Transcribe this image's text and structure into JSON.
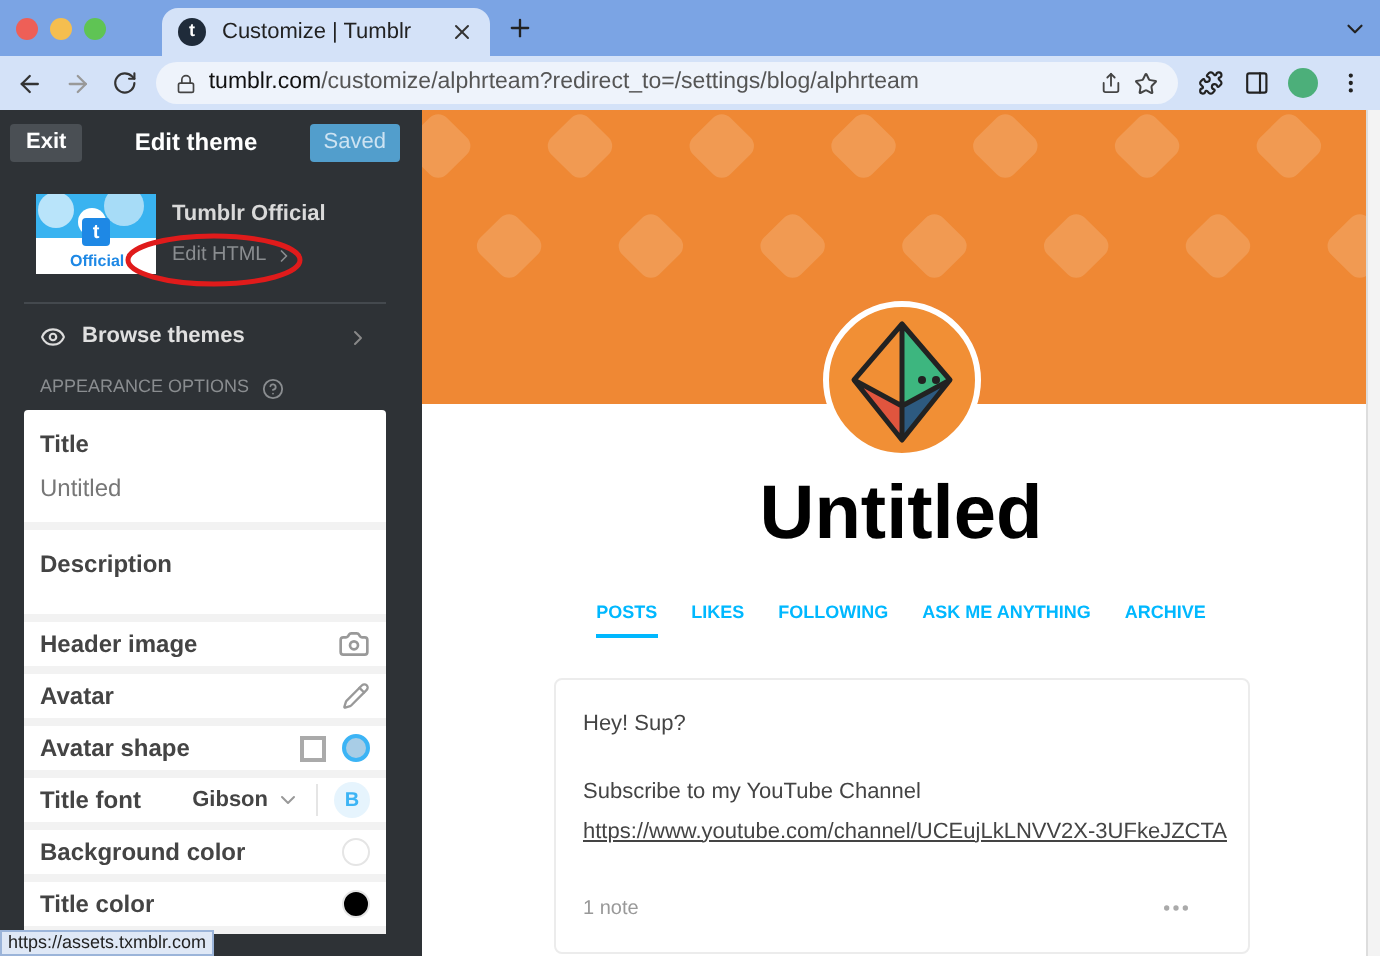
{
  "browser": {
    "tab": {
      "favicon": "t",
      "title": "Customize | Tumblr"
    },
    "url": {
      "host": "tumblr.com",
      "path": "/customize/alphrteam?redirect_to=/settings/blog/alphrteam"
    }
  },
  "sidebar": {
    "exit": "Exit",
    "title": "Edit theme",
    "saved": "Saved",
    "theme": {
      "logo": "t",
      "thumbnail_label": "Official",
      "name": "Tumblr Official",
      "edit_html": "Edit HTML"
    },
    "browse": "Browse themes",
    "section": "APPEARANCE OPTIONS",
    "options": [
      {
        "kind": "text",
        "label": "Title",
        "value": "Untitled"
      },
      {
        "kind": "textarea",
        "label": "Description"
      },
      {
        "label": "Header image"
      },
      {
        "kind": "edit",
        "label": "Avatar"
      },
      {
        "kind": "shape",
        "label": "Avatar shape",
        "choices": [
          {
            "kind": "square",
            "selected": false
          },
          {
            "kind": "circle",
            "selected": true
          }
        ]
      },
      {
        "kind": "font",
        "label": "Title font",
        "value": "Gibson",
        "bold_label": "B",
        "bold": true
      },
      {
        "kind": "color",
        "label": "Background color",
        "color": "#ffffff"
      },
      {
        "kind": "color",
        "label": "Title color",
        "color": "#000000"
      }
    ]
  },
  "status_url": "https://assets.txmblr.com",
  "blog": {
    "title": "Untitled",
    "nav": [
      {
        "label": "POSTS",
        "selected": true
      },
      {
        "label": "LIKES",
        "selected": false
      },
      {
        "label": "FOLLOWING",
        "selected": false
      },
      {
        "label": "ASK ME ANYTHING",
        "selected": false
      },
      {
        "label": "ARCHIVE",
        "selected": false
      }
    ],
    "post": {
      "lines": [
        "Hey! Sup?",
        "Subscribe to my YouTube Channel"
      ],
      "link": "https://www.youtube.com/channel/UCEujLkLNVV2X-3UFkeJZCTA",
      "notes": "1 note"
    }
  }
}
